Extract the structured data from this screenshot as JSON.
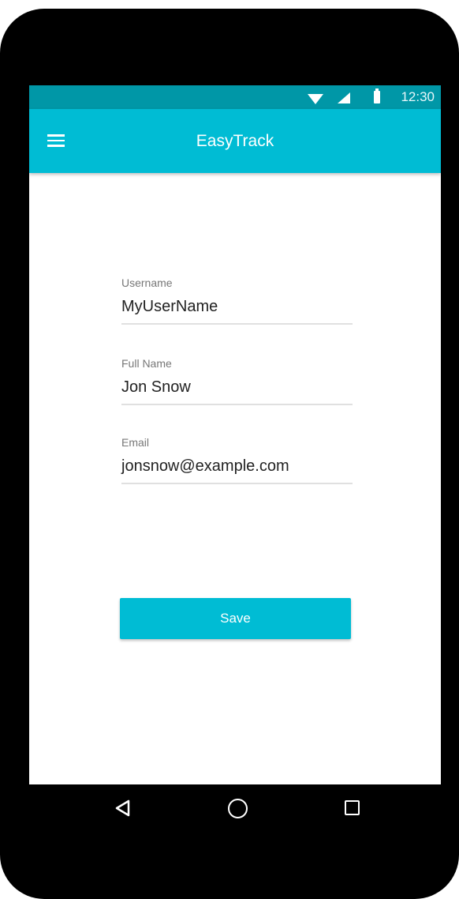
{
  "status_bar": {
    "time": "12:30",
    "icons": [
      "wifi-icon",
      "signal-icon",
      "battery-icon"
    ]
  },
  "app_bar": {
    "title": "EasyTrack",
    "menu_icon": "menu-icon",
    "color": "#00BCD4",
    "status_color": "#0097A7"
  },
  "form": {
    "username": {
      "label": "Username",
      "value": "MyUserName"
    },
    "full_name": {
      "label": "Full Name",
      "value": "Jon Snow"
    },
    "email": {
      "label": "Email",
      "value": "jonsnow@example.com"
    }
  },
  "actions": {
    "save_label": "Save"
  },
  "nav_bar": {
    "icons": [
      "back-icon",
      "home-icon",
      "recent-apps-icon"
    ]
  }
}
